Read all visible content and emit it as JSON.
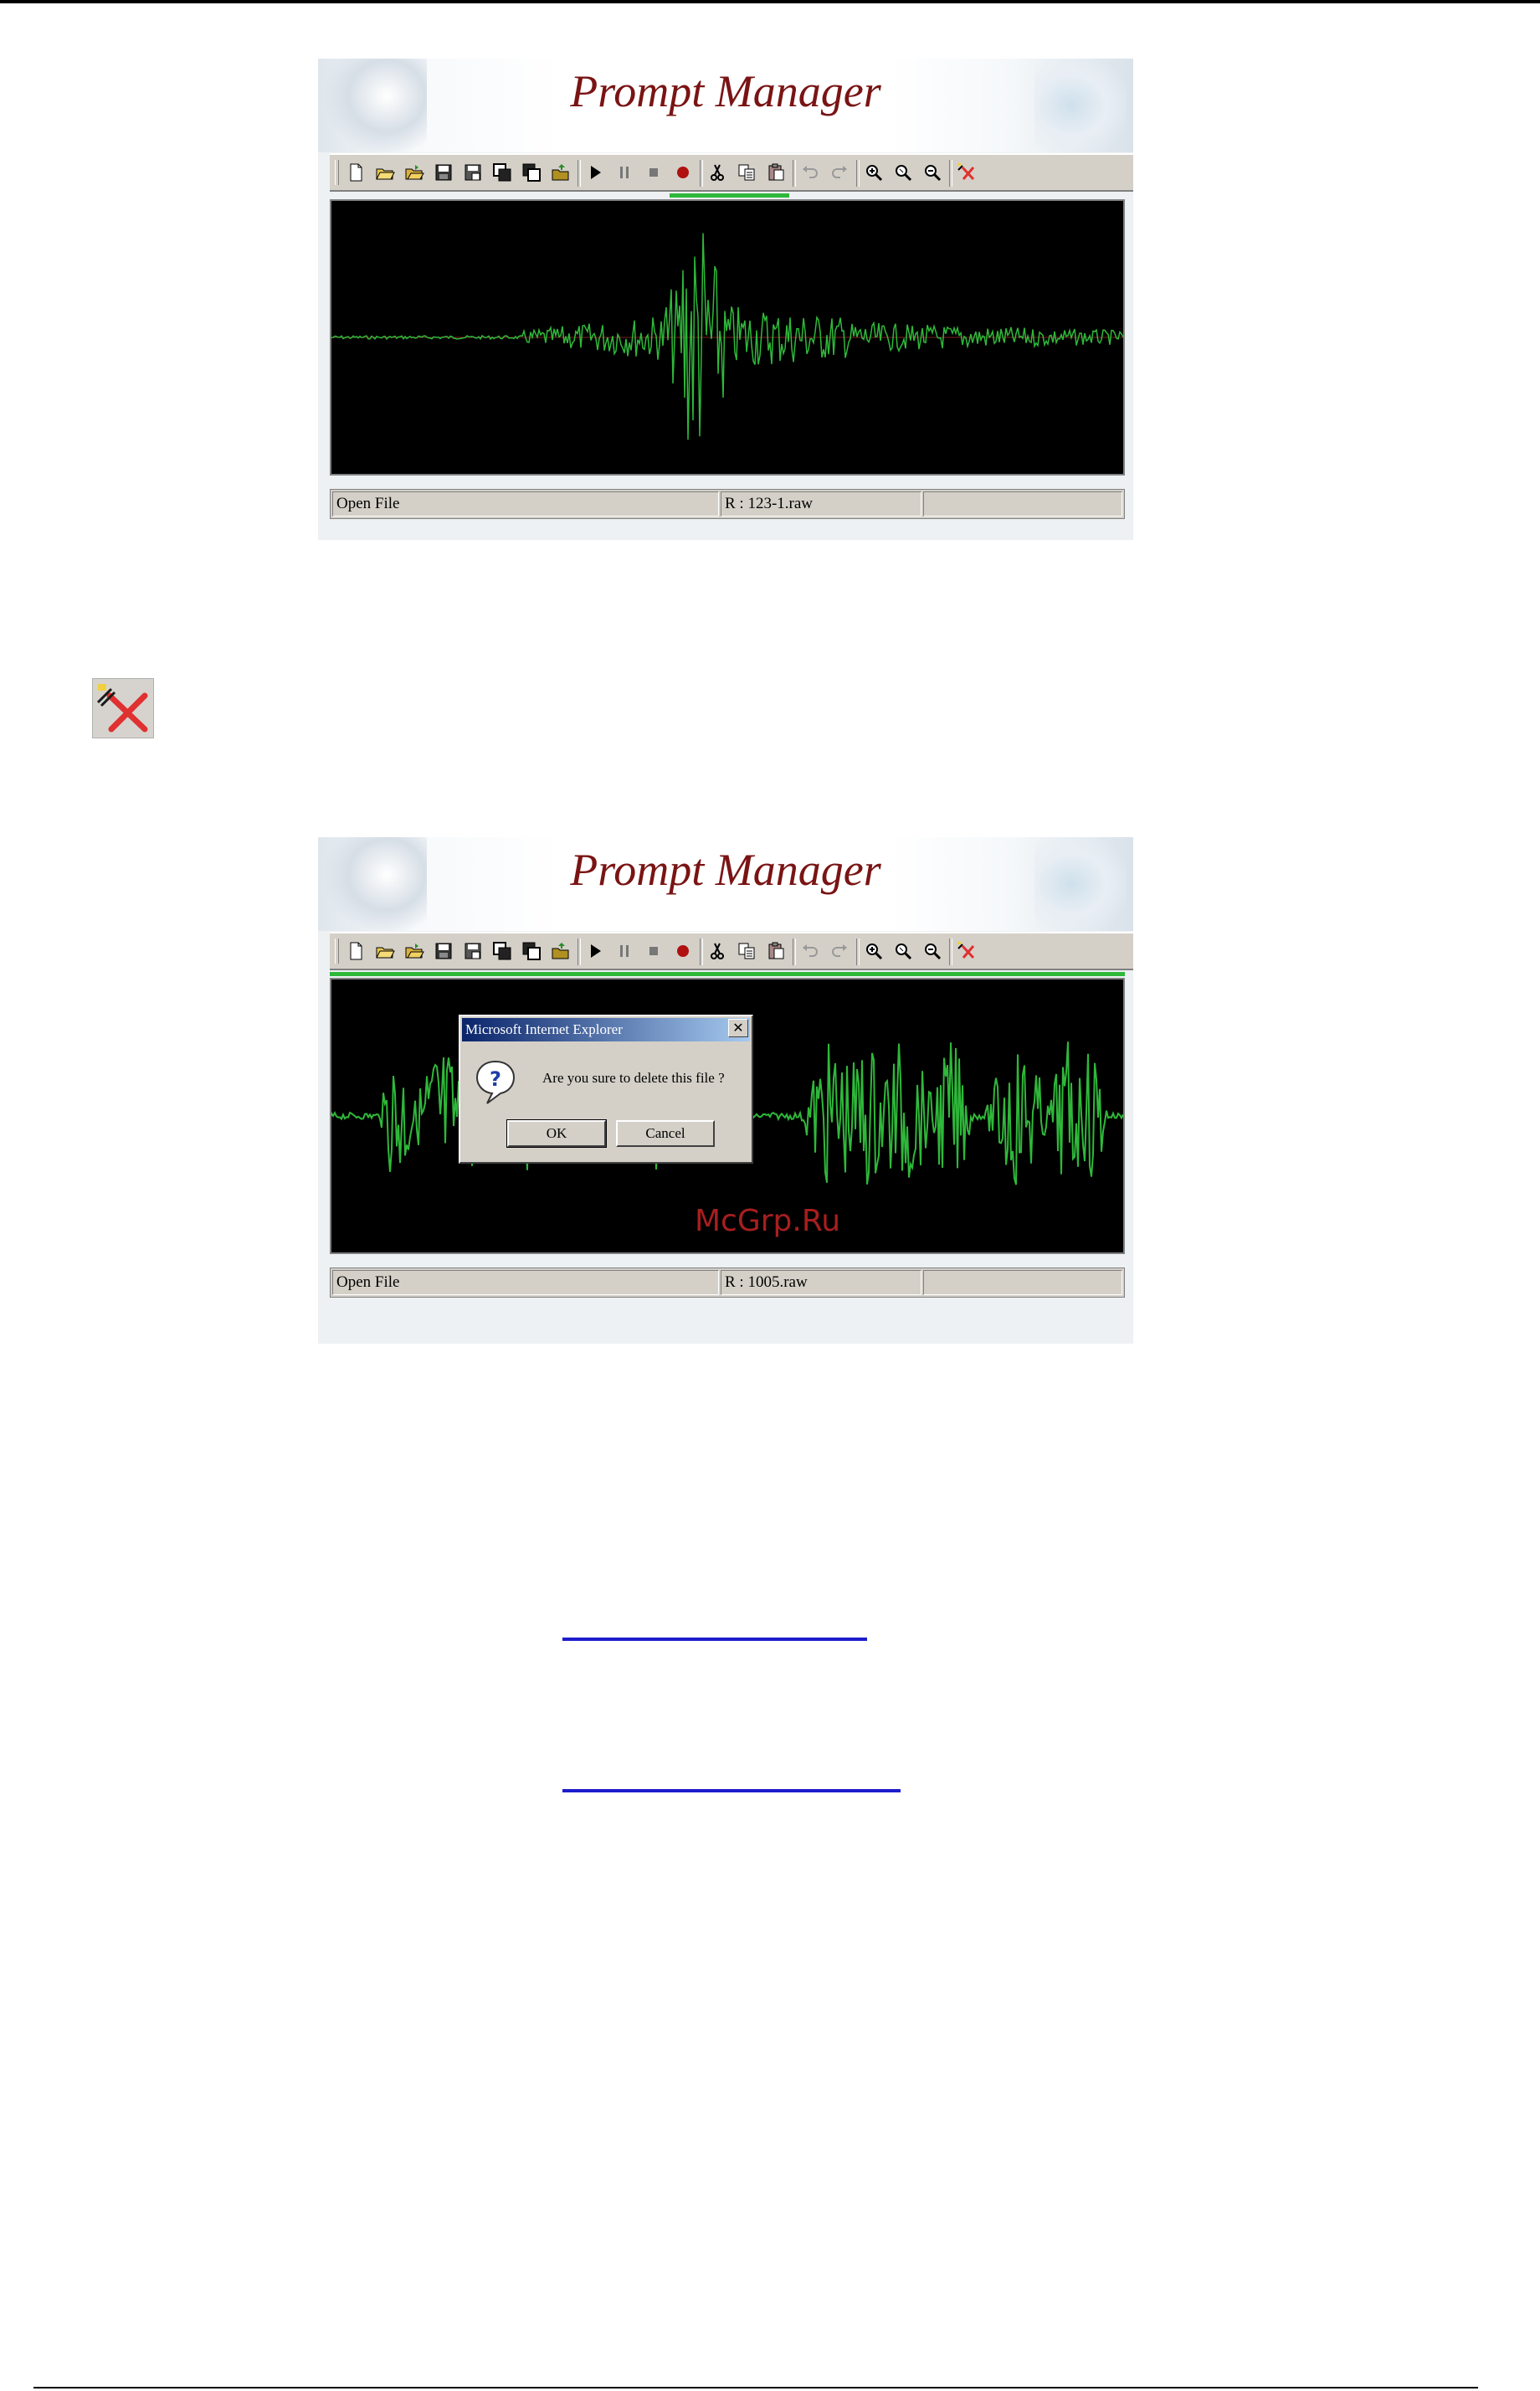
{
  "screenshot1": {
    "banner_title": "Prompt Manager",
    "status": {
      "left": "Open File",
      "middle": "R : 123-1.raw",
      "right": ""
    },
    "progress_fraction": 0.15
  },
  "screenshot2": {
    "banner_title": "Prompt Manager",
    "status": {
      "left": "Open File",
      "middle": "R : 1005.raw",
      "right": ""
    },
    "progress_fraction": 1.0,
    "dialog": {
      "title": "Microsoft Internet Explorer",
      "close_symbol": "✕",
      "message": "Are you sure to delete this file ?",
      "ok_label": "OK",
      "cancel_label": "Cancel",
      "icon": "question-icon"
    }
  },
  "toolbar_icons": [
    "new-file-icon",
    "open-icon",
    "open-folder-icon",
    "save-icon",
    "save-as-icon",
    "copy-window-icon",
    "copy-window-2-icon",
    "folder-up-icon",
    "play-icon",
    "pause-icon",
    "stop-icon",
    "record-icon",
    "cut-icon",
    "copy-icon",
    "paste-icon",
    "undo-icon",
    "redo-icon",
    "zoom-in-icon",
    "zoom-fit-icon",
    "zoom-out-icon",
    "delete-file-icon"
  ],
  "delete_icon_name": "delete-file-icon",
  "watermark": "McGrp.Ru",
  "colors": {
    "waveform": "#2fb83a",
    "banner_title": "#7a1414",
    "link": "#1d1dcc",
    "dialog_title_bar": "#0a246a"
  }
}
